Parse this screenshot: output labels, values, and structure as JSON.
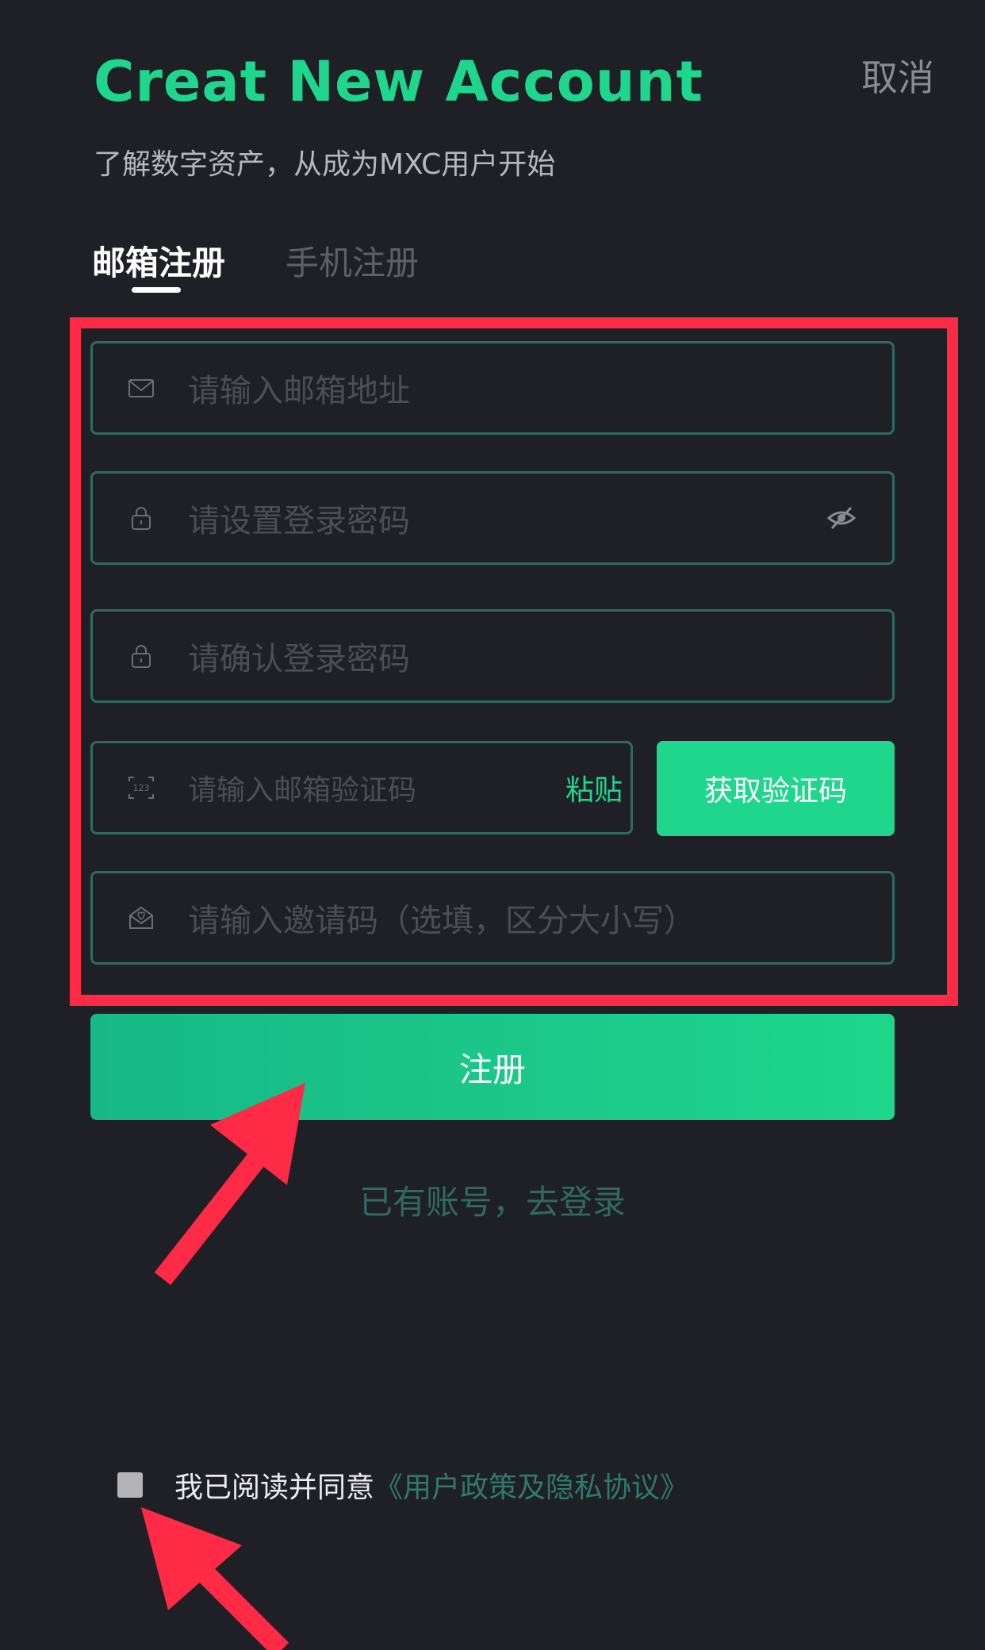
{
  "header": {
    "title": "Creat New Account",
    "cancel_label": "取消",
    "subtitle": "了解数字资产，从成为MXC用户开始"
  },
  "tabs": [
    {
      "label": "邮箱注册",
      "active": true
    },
    {
      "label": "手机注册",
      "active": false
    }
  ],
  "form": {
    "email_placeholder": "请输入邮箱地址",
    "password_placeholder": "请设置登录密码",
    "confirm_password_placeholder": "请确认登录密码",
    "code_placeholder": "请输入邮箱验证码",
    "paste_label": "粘贴",
    "get_code_label": "获取验证码",
    "invite_placeholder": "请输入邀请码（选填，区分大小写）"
  },
  "register_label": "注册",
  "login_link": "已有账号，去登录",
  "agreement": {
    "text": "我已阅读并同意",
    "link": "《用户政策及隐私协议》",
    "checked": false
  },
  "icons": {
    "email": "envelope-icon",
    "password": "lock-icon",
    "confirm": "lock-icon",
    "code": "number-123-icon",
    "invite": "gift-envelope-icon",
    "visibility": "eye-slash-icon"
  },
  "colors": {
    "background": "#1f1f26",
    "accent": "#1ed68c",
    "border": "#2f6a60",
    "annotation": "#ff2a45"
  }
}
